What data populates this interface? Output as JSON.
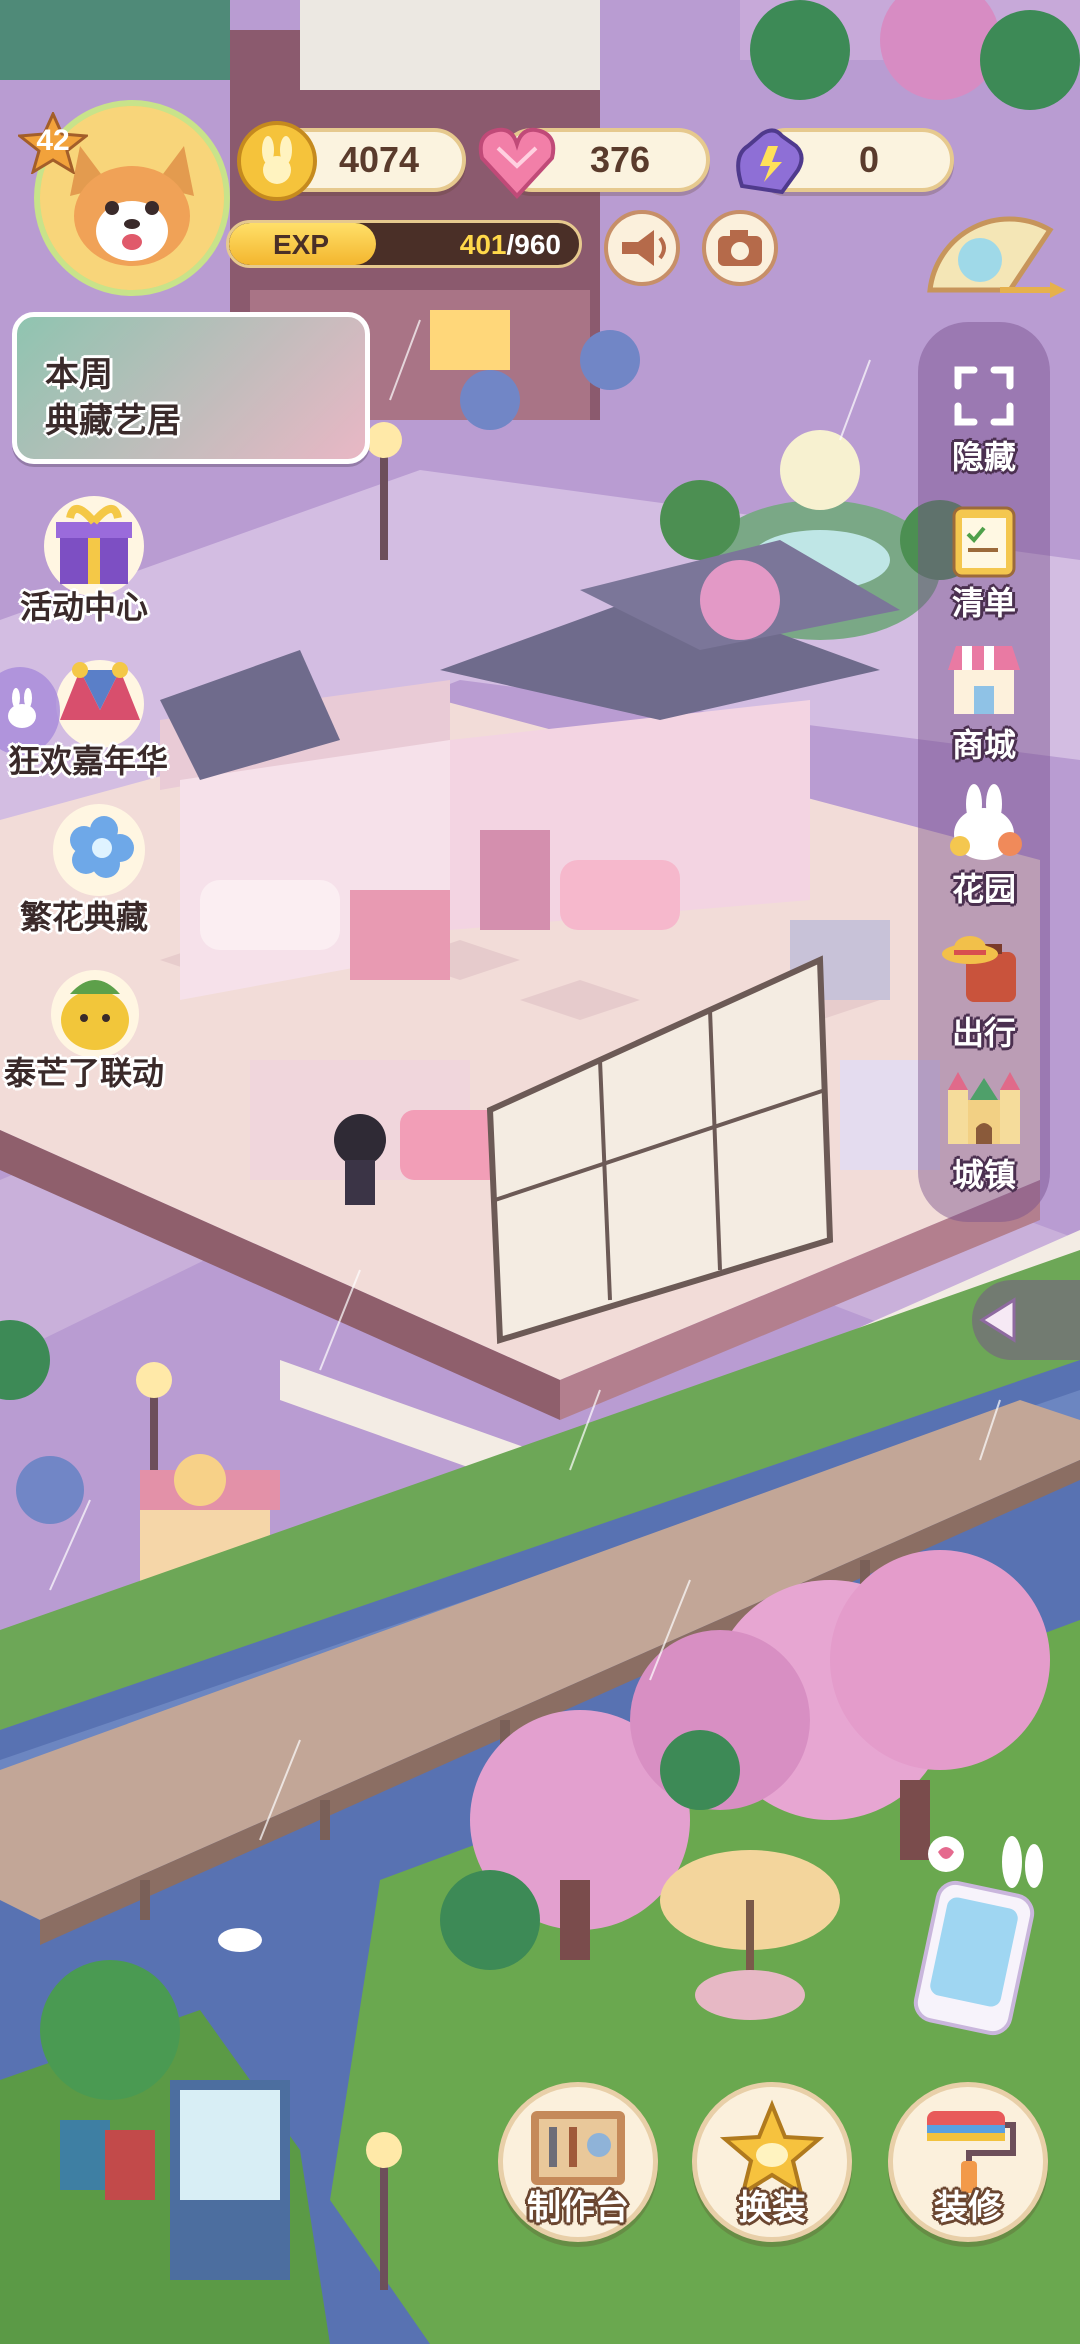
{
  "hud": {
    "level": "42",
    "coins": "4074",
    "hearts": "376",
    "energy": "0",
    "exp_label": "EXP",
    "exp_current": "401",
    "exp_separator": "/",
    "exp_max": "960",
    "exp_progress": 0.42
  },
  "weekly_banner": {
    "line1": "本周",
    "line2": "典藏艺居"
  },
  "left_menu": {
    "events": "活动中心",
    "carnival": "狂欢嘉年华",
    "flower_collection": "繁花典藏",
    "collab": "泰芒了联动"
  },
  "right_menu": {
    "hide": "隐藏",
    "checklist": "清单",
    "shop": "商城",
    "garden": "花园",
    "travel": "出行",
    "town": "城镇"
  },
  "bottom_menu": {
    "workbench": "制作台",
    "outfit": "换装",
    "decorate": "装修"
  },
  "icons": {
    "coin": "rabbit-coin-icon",
    "heart": "diamond-heart-icon",
    "energy": "purple-glove-icon",
    "announce": "megaphone-icon",
    "camera": "camera-icon",
    "hide": "fullscreen-brackets-icon",
    "checklist": "clipboard-icon",
    "shop": "storefront-icon",
    "garden": "bunny-flower-icon",
    "travel": "suitcase-hat-icon",
    "town": "castle-icon",
    "workbench": "tool-board-icon",
    "outfit": "star-glove-icon",
    "decorate": "paint-roller-icon",
    "phone": "bunny-phone-icon",
    "collapse": "triangle-left-icon"
  },
  "colors": {
    "panel": "#fbf3df",
    "panel_border": "#e6c98e",
    "text_dark": "#5a3b2c",
    "exp_highlight": "#ffd84a",
    "sidebar": "#78508c",
    "pink_tree": "#e6a3cc",
    "water": "#5a78b4",
    "boardwalk": "#c4a896",
    "road": "#d6bfe0"
  }
}
